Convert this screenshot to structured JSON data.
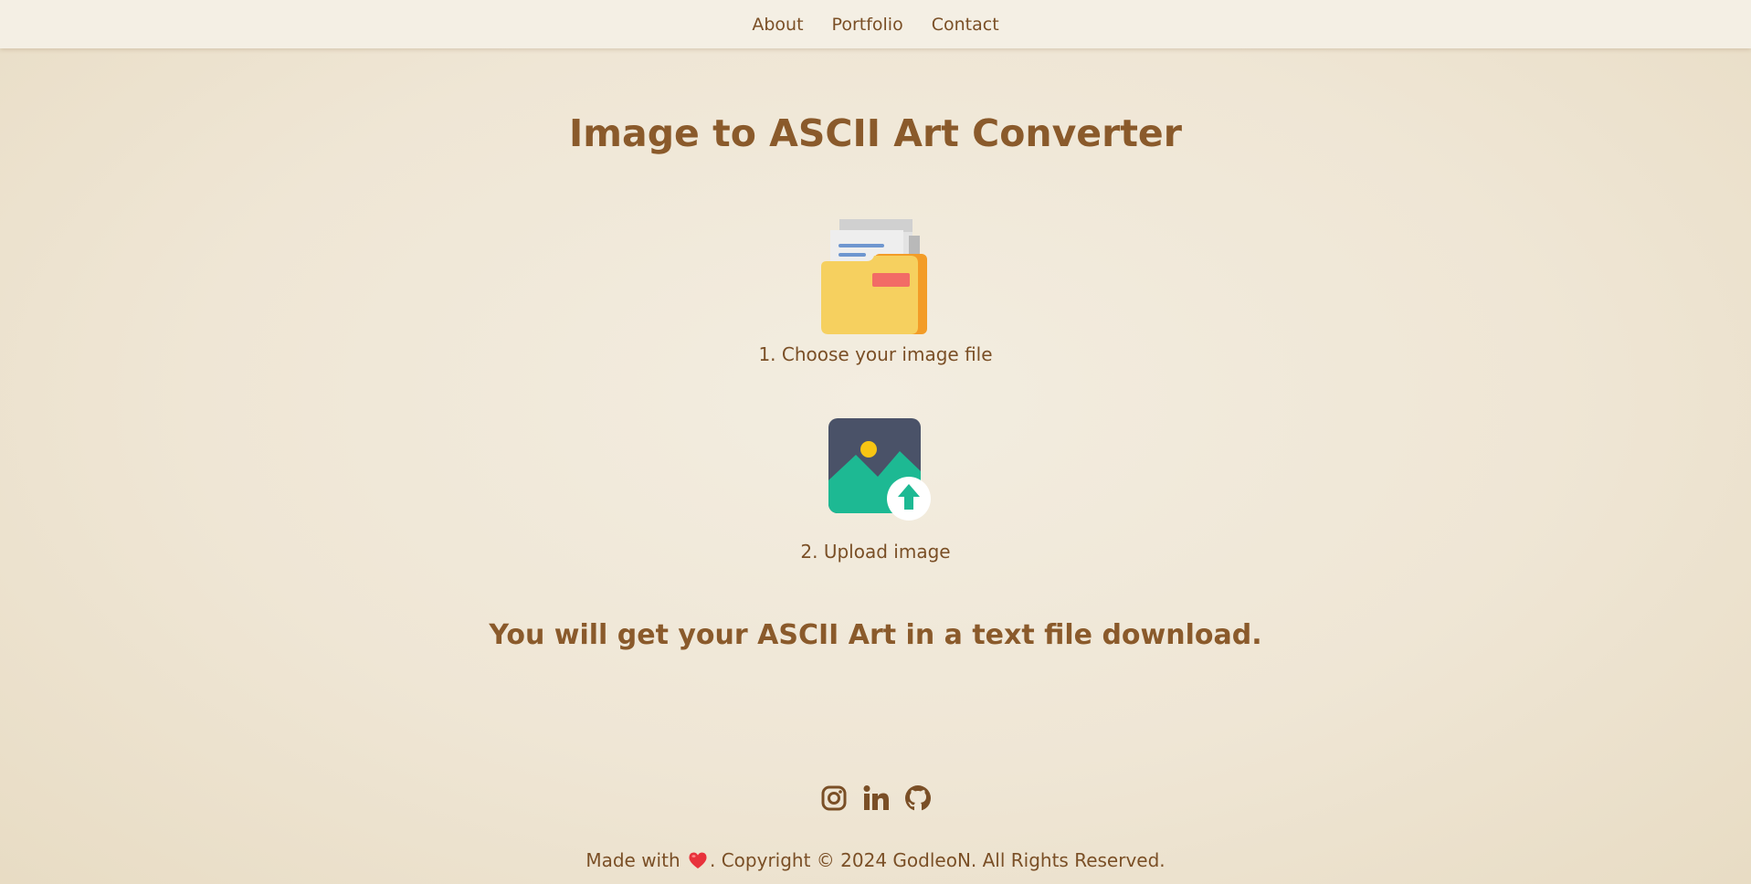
{
  "nav": {
    "items": [
      {
        "label": "About"
      },
      {
        "label": "Portfolio"
      },
      {
        "label": "Contact"
      }
    ]
  },
  "page": {
    "title": "Image to ASCII Art Converter"
  },
  "steps": [
    {
      "label": "1. Choose your image file",
      "icon": "folder-icon"
    },
    {
      "label": "2. Upload image",
      "icon": "image-upload-icon"
    }
  ],
  "result": {
    "text": "You will get your ASCII Art in a text file download."
  },
  "socials": [
    {
      "icon": "instagram-icon"
    },
    {
      "icon": "linkedin-icon"
    },
    {
      "icon": "github-icon"
    }
  ],
  "footer": {
    "made_with": "Made with",
    "heart_icon": "heart-icon",
    "copyright": ". Copyright © 2024 GodleoN. All Rights Reserved."
  },
  "colors": {
    "text": "#7a4f26",
    "heading": "#8a5a2b",
    "background": "#efe6d5",
    "nav_background": "#f4efe4"
  }
}
